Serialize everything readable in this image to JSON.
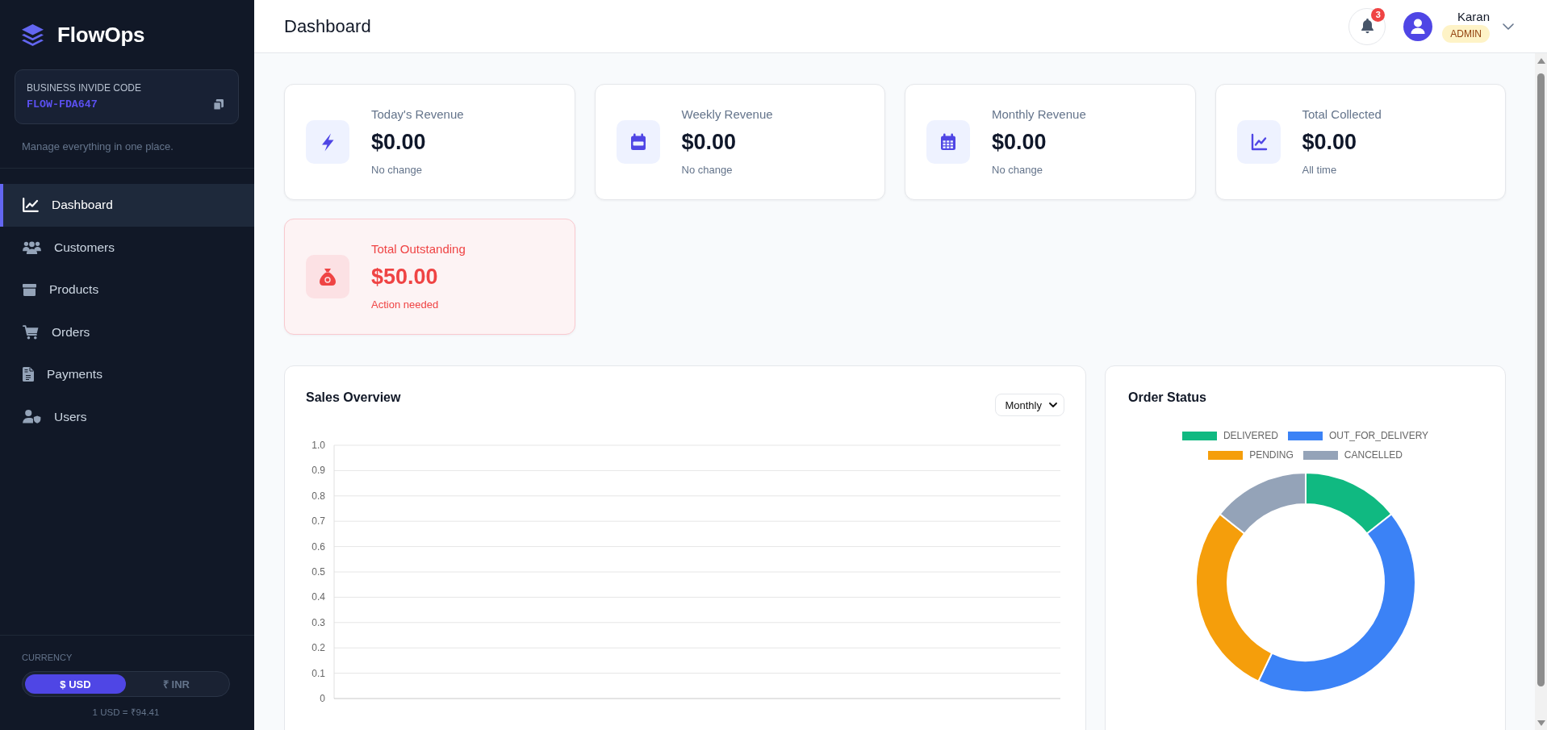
{
  "sidebar": {
    "brand": "FlowOps",
    "invite_code": {
      "label": "BUSINESS INVIDE CODE",
      "code": "FLOW-FDA647"
    },
    "tagline": "Manage everything in one place.",
    "items": [
      {
        "label": "Dashboard",
        "selected": true
      },
      {
        "label": "Customers",
        "selected": false
      },
      {
        "label": "Products",
        "selected": false
      },
      {
        "label": "Orders",
        "selected": false
      },
      {
        "label": "Payments",
        "selected": false
      },
      {
        "label": "Users",
        "selected": false
      }
    ],
    "currency": {
      "label": "CURRENCY",
      "options": [
        {
          "label": "$ USD",
          "selected": true
        },
        {
          "label": "₹ INR",
          "selected": false
        }
      ],
      "rate": "1 USD = ₹94.41"
    }
  },
  "header": {
    "title": "Dashboard",
    "notifications": {
      "count": "3"
    },
    "user": {
      "name": "Karan",
      "role": "ADMIN"
    }
  },
  "stat_cards": [
    {
      "kind": "stat",
      "title": "Today's Revenue",
      "value": "$0.00",
      "note": "No change"
    },
    {
      "kind": "stat",
      "title": "Weekly Revenue",
      "value": "$0.00",
      "note": "No change"
    },
    {
      "kind": "stat",
      "title": "Monthly Revenue",
      "value": "$0.00",
      "note": "No change"
    },
    {
      "kind": "stat",
      "title": "Total Collected",
      "value": "$0.00",
      "note": "All time"
    },
    {
      "kind": "alert",
      "title": "Total Outstanding",
      "value": "$50.00",
      "note": "Action needed"
    }
  ],
  "sales_overview": {
    "title": "Sales Overview",
    "period": "Monthly",
    "y_axis_labels": [
      "1.0",
      "0.9",
      "0.8",
      "0.7",
      "0.6",
      "0.5",
      "0.4",
      "0.3",
      "0.2",
      "0.1",
      "0"
    ]
  },
  "order_status": {
    "title": "Order Status",
    "chart_data": {
      "type": "donut",
      "legend": "top",
      "categories": [
        "DELIVERED",
        "OUT_FOR_DELIVERY",
        "PENDING",
        "CANCELLED"
      ],
      "values": [
        14.3,
        42.8,
        28.6,
        14.3
      ],
      "colors": [
        "#10b981",
        "#3b82f6",
        "#f59e0b",
        "#94a3b8"
      ]
    }
  }
}
